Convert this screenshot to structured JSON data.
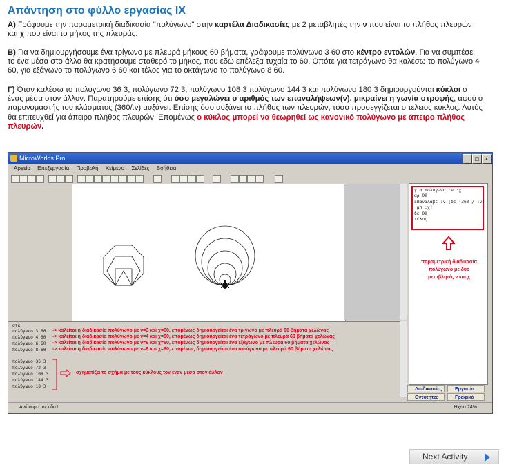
{
  "title": "Απάντηση στο φύλλο εργασίας ΙΧ",
  "paragraphs": {
    "a": {
      "prefix": "Α)",
      "t1": " Γράφουμε την παραμετρική διαδικασία \"πολύγωνο\" στην ",
      "b1": "καρτέλα Διαδικασίες",
      "t2": " με 2 μεταβλητές την ",
      "b2": "ν",
      "t3": " που είναι το πλήθος πλευρών και ",
      "b3": "χ",
      "t4": " που είναι το μήκος της πλευράς."
    },
    "b": {
      "prefix": "Β)",
      "t1": " Για να δημιουργήσουμε ένα τρίγωνο με πλευρά μήκους 60 βήματα, γράφουμε πολύγωνο 3 60 στο ",
      "b1": "κέντρο εντολών",
      "t2": ". Για να συμπέσει το ένα μέσα στο άλλο θα κρατήσουμε σταθερό το μήκος, που εδώ επέλεξα τυχαία το 60. Οπότε για τετράγωνο θα καλέσω το πολύγωνο 4 60, για εξάγωνο το πολύγωνο 6 60  και τέλος για το οκτάγωνο το πολύγωνο 8 60."
    },
    "c": {
      "prefix": "Γ)",
      "t1": " Όταν καλέσω το πολύγωνο 36 3, πολύγωνο 72 3, πολύγωνο 108 3 πολύγωνο 144 3 και πολύγωνο 180 3 δημιουργούνται ",
      "b1": "κύκλοι",
      "t2": " ο ένας μέσα στον άλλον. Παρατηρούμε επίσης ότι ",
      "b2": "όσο μεγαλώνει ο αριθμός των επαναλήψεων(ν), μικραίνει η γωνία στροφής",
      "t3": ", αφού ο παρονομαστής του κλάσματος (360/:ν) αυξάνει. Επίσης όσο αυξάνει το πλήθος των πλευρών, τόσο προσεγγίζεται ο τέλειος κύκλος. Αυτός θα επιτευχθεί για άπειρο πλήθος πλευρών. Επομένως ",
      "r1": "ο κύκλος μπορεί να θεωρηθεί ως κανονικό πολύγωνο με άπειρο πλήθος πλευρών",
      "t4": "."
    }
  },
  "window": {
    "title": "MicroWorlds Pro",
    "menu": [
      "Αρχείο",
      "Επεξεργασία",
      "Προβολή",
      "Κείμενο",
      "Σελίδες",
      "Βοήθεια"
    ],
    "code": [
      "για πολύγωνο :ν :χ",
      "αρ 90",
      "επανάλαβε :ν [δε (360 / :ν)",
      " μπ :χ]",
      "δε 90",
      "τέλος"
    ],
    "proc_note": "παραμετρική διαδικασία πολύγωνο με δύο μεταβλητές ν και χ",
    "commands_top": [
      "στκ",
      "πολύγωνο 3 60",
      "πολύγωνο 4 60",
      "πολύγωνο 6 60",
      "πολύγωνο 8 60"
    ],
    "notes_top": [
      "-> καλείται η διαδικασία πολύγωνο με ν=3 και χ=60, επομένως δημιουργείται ένα τρίγωνο με πλευρά 60 βήματα χελώνας",
      "-> καλείται η διαδικασία πολύγωνο με ν=4 και χ=60, επομένως δημιουργείται ένα τετράγωνο με πλευρά 60 βήματα χελώνας",
      "-> καλείται η διαδικασία πολύγωνο με ν=6 και χ=60, επομένως δημιουργείται ένα εξάγωνο με πλευρά 60 βήματα χελώνας",
      "-> καλείται η διαδικασία πολύγωνο με ν=8 και χ=60, επομένως δημιουργείται ένα οκτάγωνο με πλευρά 60 βήματα χελώνας"
    ],
    "commands_bottom": [
      "πολύγωνο 36 3",
      "πολύγωνο 72 3",
      "πολύγωνο 108 3",
      "πολύγωνο 144 3",
      "πολύγωνο 18 3"
    ],
    "note_bottom": "σχηματίζει το σχήμα με τους κύκλους τον έναν μέσα στον άλλον",
    "tabs": [
      "Διαδικασίες",
      "Εργασία",
      "Οντότητες",
      "Γραφικά"
    ],
    "status_left": "Ανώνυμο: σελίδα1",
    "status_right": "Ηχεία 24%"
  },
  "next_button": "Next Activity",
  "colors": {
    "accent": "#1a75bb",
    "highlight_red": "#e0001b"
  }
}
